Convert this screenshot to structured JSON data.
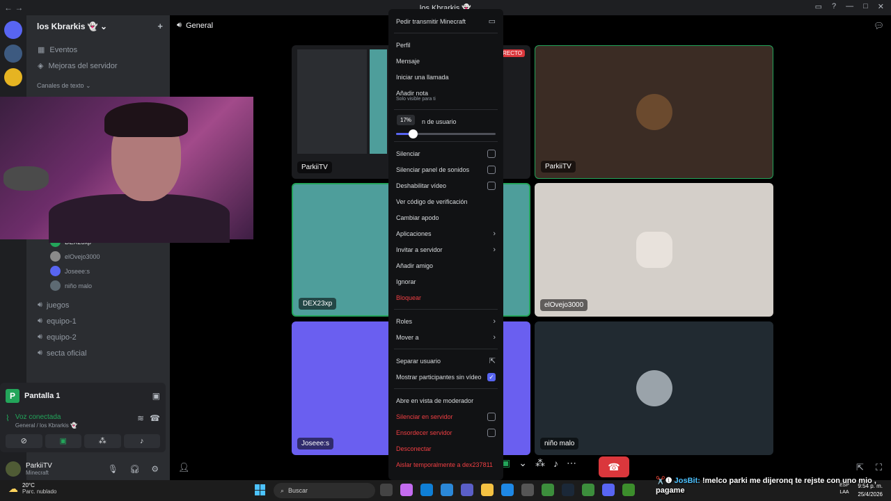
{
  "window": {
    "title": "los Kbrarkis 👻"
  },
  "server": {
    "name": "los Kbrarkis 👻"
  },
  "sidebar": {
    "events": "Eventos",
    "boosts": "Mejoras del servidor",
    "text_category": "Canales de texto",
    "voice_users": [
      {
        "name": "DEX23xp",
        "color": "#23a55a"
      },
      {
        "name": "elOvejo3000",
        "color": "#8a8a8a"
      },
      {
        "name": "Joseee:s",
        "color": "#5865f2"
      },
      {
        "name": "niño malo",
        "color": "#5d6a73"
      }
    ],
    "voice_channels": [
      "juegos",
      "equipo-1",
      "equipo-2",
      "secta oficial"
    ]
  },
  "panel": {
    "screen_label": "Pantalla 1",
    "screen_initial": "P",
    "voice_status": "Voz conectada",
    "voice_location": "General / los Kbrarkis 👻"
  },
  "user": {
    "name": "ParkiiTV",
    "activity": "Minecraft"
  },
  "stage": {
    "channel": "General",
    "tiles": [
      {
        "label": "ParkiiTV",
        "bg": "#1b1c1f"
      },
      {
        "label": "ParkiiTV",
        "bg": "#3b2c24"
      },
      {
        "label": "DEX23xp",
        "bg": "#4e9e9b"
      },
      {
        "label": "elOvejo3000",
        "bg": "#d4cfc9"
      },
      {
        "label": "Joseee:s",
        "bg": "#6a5ff0"
      },
      {
        "label": "niño malo",
        "bg": "#212a31"
      }
    ],
    "live_badge": "DIRECTO"
  },
  "context_menu": {
    "stream_request": "Pedir transmitir Minecraft",
    "profile": "Perfil",
    "message": "Mensaje",
    "call": "Iniciar una llamada",
    "add_note": "Añadir nota",
    "note_hint": "Solo visible para ti",
    "volume_label": "Volumen de usuario",
    "volume_label_visible": "n de usuario",
    "volume_tooltip": "17%",
    "volume_value": 0.17,
    "mute": "Silenciar",
    "mute_soundboard": "Silenciar panel de sonidos",
    "disable_video": "Deshabilitar vídeo",
    "verify_code": "Ver código de verificación",
    "change_nick": "Cambiar apodo",
    "apps": "Aplicaciones",
    "invite": "Invitar a servidor",
    "add_friend": "Añadir amigo",
    "ignore": "Ignorar",
    "block": "Bloquear",
    "roles": "Roles",
    "move_to": "Mover a",
    "separate_user": "Separar usuario",
    "show_no_video": "Mostrar participantes sin vídeo",
    "moderator_view": "Abre en vista de moderador",
    "server_mute": "Silenciar en servidor",
    "server_deafen": "Ensordecer servidor",
    "disconnect": "Desconectar",
    "timeout": "Aislar temporalmente a dex237811"
  },
  "taskbar": {
    "temperature": "20°C",
    "weather": "Parc. nublado",
    "search_placeholder": "Buscar",
    "lang_1": "ESP",
    "lang_2": "LAA",
    "time": "9:54 p. m.",
    "date": "25/4/2026"
  },
  "chat_overlay": {
    "prefix": "✂️❶",
    "user": "JosBit:",
    "message": "!melco parki me dijeronq te rejste con uno mio , pagame"
  },
  "colors": {
    "accent": "#5865f2",
    "green": "#23a55a",
    "danger": "#f23f43"
  }
}
